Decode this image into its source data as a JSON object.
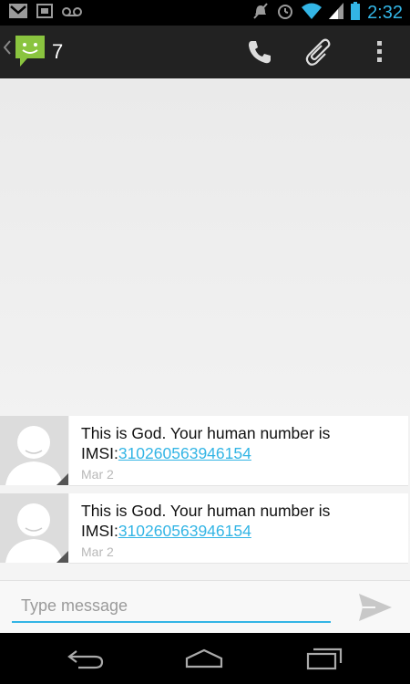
{
  "status_bar": {
    "icons_left": [
      "gmail-icon",
      "photo-icon",
      "voicemail-icon"
    ],
    "icons_right": [
      "mute-icon",
      "alarm-icon",
      "wifi-icon",
      "signal-icon",
      "battery-icon"
    ],
    "time": "2:32"
  },
  "action_bar": {
    "title": "7",
    "icons": [
      "back-chevron-icon",
      "messaging-app-icon",
      "phone-icon",
      "attach-icon",
      "overflow-menu-icon"
    ]
  },
  "messages": [
    {
      "text_prefix": "This is God. Your human number is IMSI:",
      "link": "310260563946154",
      "date": "Mar 2"
    },
    {
      "text_prefix": "This is God. Your human number is IMSI:",
      "link": "310260563946154",
      "date": "Mar 2"
    }
  ],
  "compose": {
    "placeholder": "Type message",
    "value": ""
  },
  "nav_bar": {
    "icons": [
      "back-icon",
      "home-icon",
      "recents-icon"
    ]
  },
  "colors": {
    "accent": "#33b5e5",
    "action_bar": "#222222",
    "conversation_bg": "#eeeeee",
    "app_icon_green": "#8ac43f"
  }
}
